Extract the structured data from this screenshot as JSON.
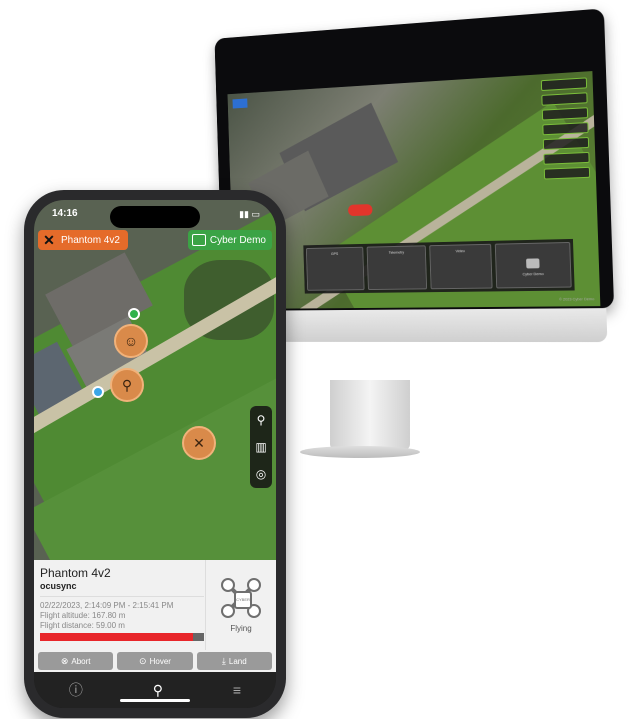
{
  "phone": {
    "time": "14:16",
    "drone_name": "Phantom 4v2",
    "organization": "Cyber Demo",
    "info": {
      "title": "Phantom 4v2",
      "link": "ocusync",
      "flight_window": "02/22/2023, 2:14:09 PM - 2:15:41 PM",
      "altitude": "Flight altitude: 167.80 m",
      "distance": "Flight distance: 59.00 m",
      "progress_fraction": 0.93,
      "status": "Flying",
      "drone_image_label": "CYBER"
    },
    "actions": [
      {
        "label": "Abort",
        "icon": "x-circle-icon"
      },
      {
        "label": "Hover",
        "icon": "hover-circle-icon"
      },
      {
        "label": "Land",
        "icon": "land-arrow-icon"
      }
    ],
    "tabs": [
      {
        "name": "info",
        "icon": "info-icon"
      },
      {
        "name": "map",
        "icon": "map-pin-icon"
      },
      {
        "name": "menu",
        "icon": "menu-icon"
      }
    ],
    "colors": {
      "drone_badge": "#e56b2a",
      "org_badge": "#3ba345",
      "progress": "#e8262a"
    }
  },
  "desktop": {
    "panel_cards": [
      "GPS",
      "Telemetry",
      "Video"
    ],
    "org_label": "Cyber Demo",
    "footer": "© 2023 Cyber Demo"
  }
}
